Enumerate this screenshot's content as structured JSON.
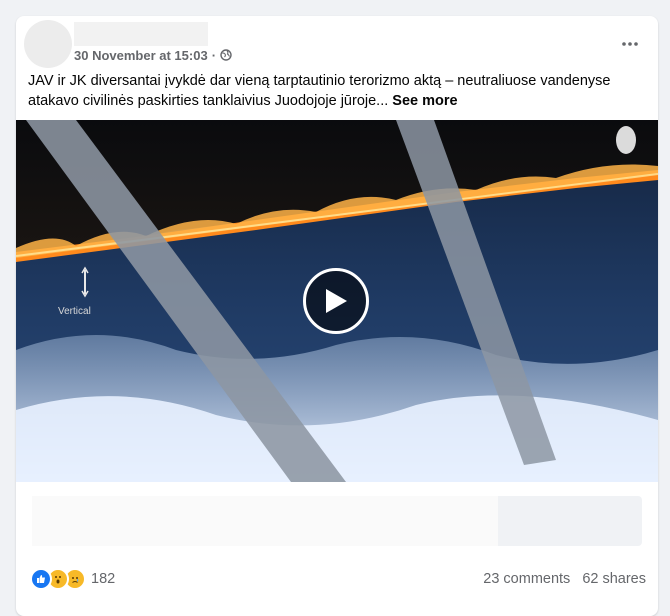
{
  "post": {
    "timestamp": "30 November at 15:03",
    "privacy_icon": "globe-icon",
    "text": "JAV ir JK diversantai įvykdė dar vieną tarptautinio terorizmo aktą – neutraliuose vandenyse atakavo civilinės paskirties tanklaivius Juodojoje jūroje...",
    "see_more_label": "See more",
    "video_overlay_text": "Vertical"
  },
  "footer": {
    "reaction_count": "182",
    "comments": "23 comments",
    "shares": "62 shares",
    "reaction_icons": [
      "like-icon",
      "wow-icon",
      "sad-icon"
    ]
  },
  "colors": {
    "like_blue": "#1877f2",
    "emoji_yellow": "#f7b928",
    "secondary_text": "#65676b",
    "fire_orange": "#ff8a1c"
  }
}
